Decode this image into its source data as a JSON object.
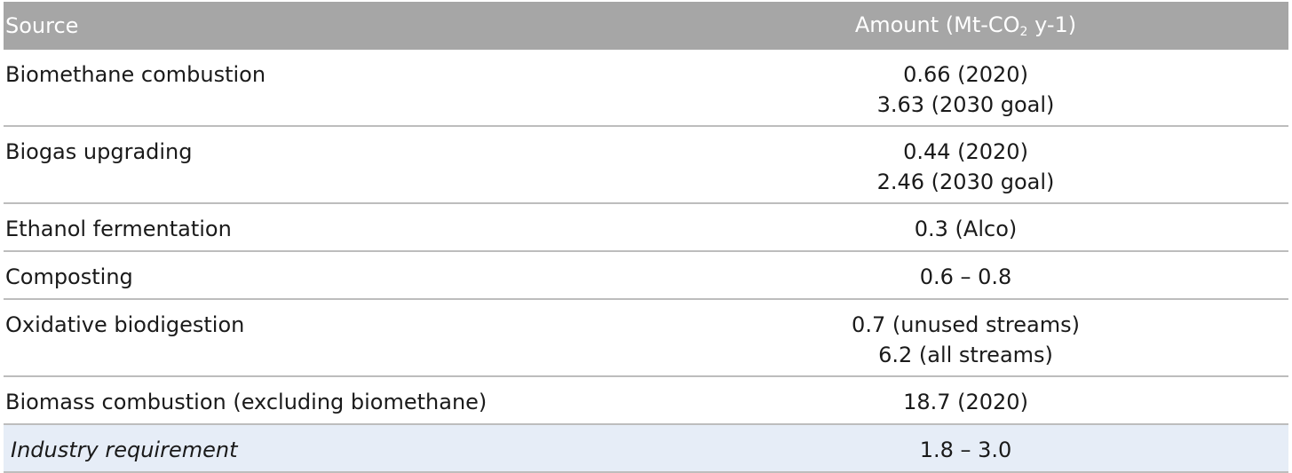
{
  "header": {
    "source": "Source",
    "amount_prefix": "Amount (Mt-CO",
    "amount_sub": "2",
    "amount_suffix": " y-1)"
  },
  "rows": [
    {
      "source": "Biomethane combustion",
      "amount": [
        "0.66 (2020)",
        "3.63 (2030 goal)"
      ]
    },
    {
      "source": "Biogas upgrading",
      "amount": [
        "0.44 (2020)",
        "2.46 (2030 goal)"
      ]
    },
    {
      "source": "Ethanol fermentation",
      "amount": [
        "0.3 (Alco)"
      ]
    },
    {
      "source": "Composting",
      "amount": [
        "0.6 – 0.8"
      ]
    },
    {
      "source": "Oxidative biodigestion",
      "amount": [
        "0.7 (unused streams)",
        "6.2 (all streams)"
      ]
    },
    {
      "source": "Biomass combustion (excluding biomethane)",
      "amount": [
        "18.7 (2020)"
      ]
    },
    {
      "source": "Industry requirement",
      "amount": [
        "1.8 – 3.0"
      ]
    }
  ],
  "colors": {
    "header_bg": "#a6a6a6",
    "highlight_row_bg": "#e6edf7",
    "row_divider": "#bdbdbd"
  }
}
